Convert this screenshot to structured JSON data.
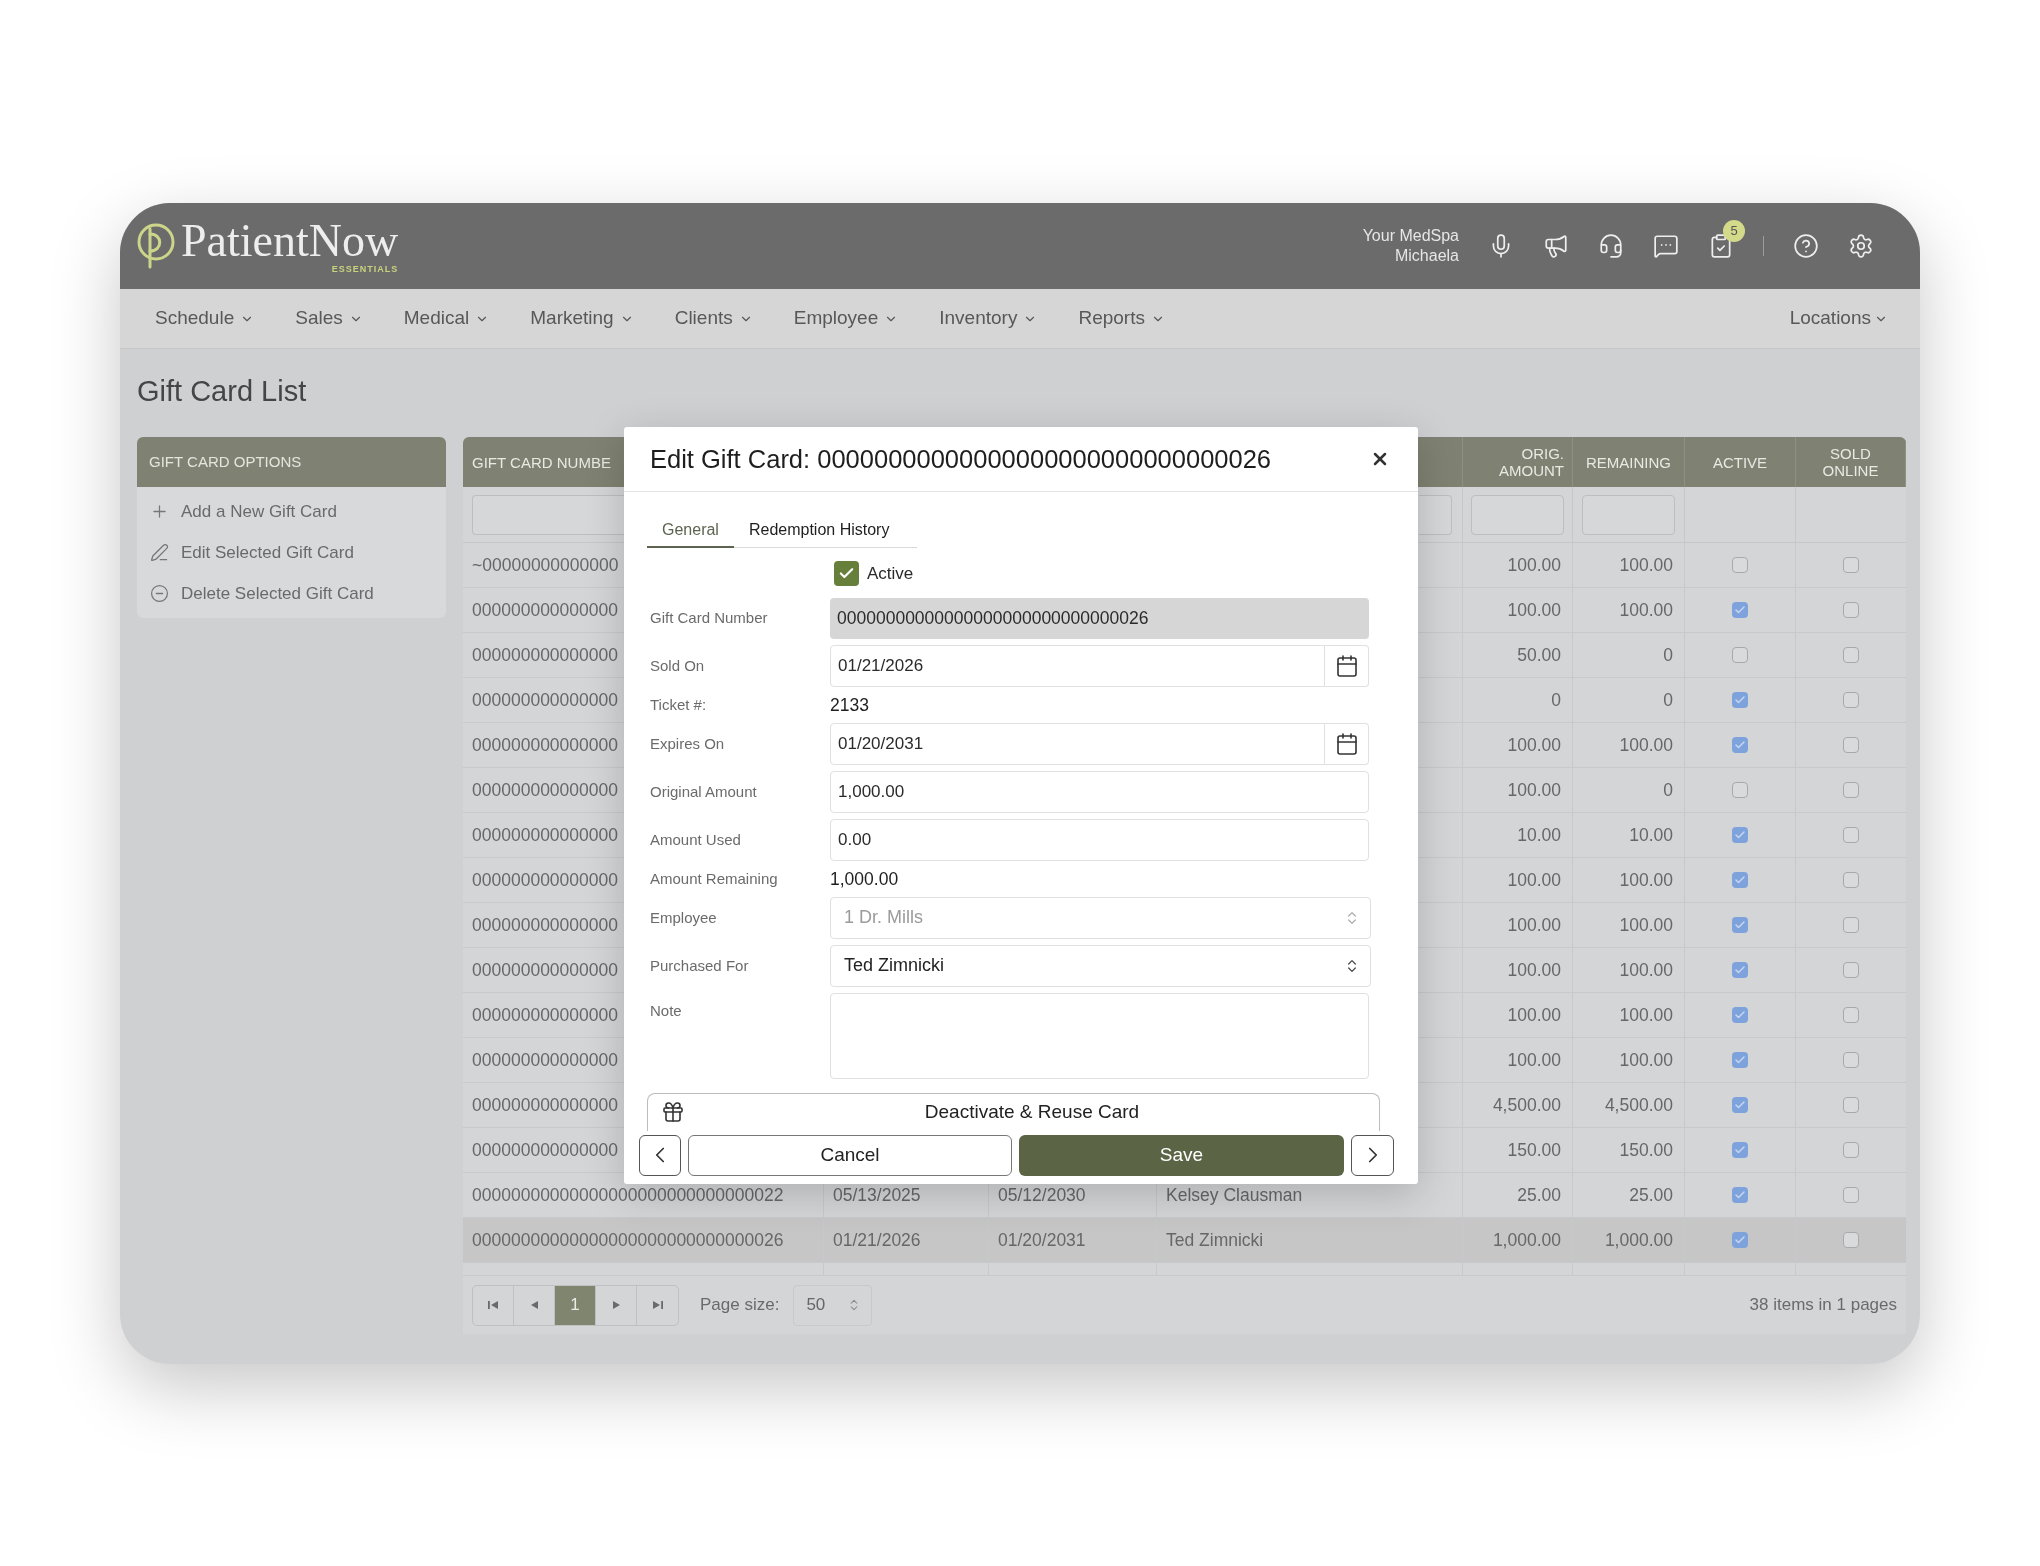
{
  "header": {
    "logo": {
      "name": "PatientNow",
      "tagline": "ESSENTIALS"
    },
    "account": {
      "business": "Your MedSpa",
      "user": "Michaela"
    },
    "tasks_badge": "5"
  },
  "nav": {
    "items": [
      "Schedule",
      "Sales",
      "Medical",
      "Marketing",
      "Clients",
      "Employee",
      "Inventory",
      "Reports"
    ],
    "locations": "Locations"
  },
  "page_title": "Gift Card List",
  "sidebar": {
    "title": "GIFT CARD OPTIONS",
    "items": [
      {
        "kind": "add",
        "label": "Add a New Gift Card"
      },
      {
        "kind": "edit",
        "label": "Edit Selected Gift Card"
      },
      {
        "kind": "delete",
        "label": "Delete Selected Gift Card"
      }
    ]
  },
  "table": {
    "columns": [
      "GIFT CARD NUMBE",
      "ORIG. AMOUNT",
      "REMAINING",
      "ACTIVE",
      "SOLD ONLINE"
    ],
    "rows": [
      {
        "gift_card_number": "~00000000000000",
        "orig_amount": "100.00",
        "remaining": "100.00",
        "active": false,
        "sold_online": false,
        "selected": false
      },
      {
        "gift_card_number": "000000000000000",
        "orig_amount": "100.00",
        "remaining": "100.00",
        "active": true,
        "sold_online": false,
        "selected": false
      },
      {
        "gift_card_number": "000000000000000",
        "orig_amount": "50.00",
        "remaining": "0",
        "active": false,
        "sold_online": false,
        "selected": false
      },
      {
        "gift_card_number": "000000000000000",
        "orig_amount": "0",
        "remaining": "0",
        "active": true,
        "sold_online": false,
        "selected": false
      },
      {
        "gift_card_number": "000000000000000",
        "orig_amount": "100.00",
        "remaining": "100.00",
        "active": true,
        "sold_online": false,
        "selected": false
      },
      {
        "gift_card_number": "000000000000000",
        "orig_amount": "100.00",
        "remaining": "0",
        "active": false,
        "sold_online": false,
        "selected": false
      },
      {
        "gift_card_number": "000000000000000",
        "orig_amount": "10.00",
        "remaining": "10.00",
        "active": true,
        "sold_online": false,
        "selected": false
      },
      {
        "gift_card_number": "000000000000000",
        "orig_amount": "100.00",
        "remaining": "100.00",
        "active": true,
        "sold_online": false,
        "selected": false
      },
      {
        "gift_card_number": "000000000000000",
        "orig_amount": "100.00",
        "remaining": "100.00",
        "active": true,
        "sold_online": false,
        "selected": false
      },
      {
        "gift_card_number": "000000000000000",
        "orig_amount": "100.00",
        "remaining": "100.00",
        "active": true,
        "sold_online": false,
        "selected": false
      },
      {
        "gift_card_number": "000000000000000",
        "orig_amount": "100.00",
        "remaining": "100.00",
        "active": true,
        "sold_online": false,
        "selected": false
      },
      {
        "gift_card_number": "000000000000000",
        "orig_amount": "100.00",
        "remaining": "100.00",
        "active": true,
        "sold_online": false,
        "selected": false
      },
      {
        "gift_card_number": "000000000000000",
        "orig_amount": "4,500.00",
        "remaining": "4,500.00",
        "active": true,
        "sold_online": false,
        "selected": false
      },
      {
        "gift_card_number": "000000000000000",
        "orig_amount": "150.00",
        "remaining": "150.00",
        "active": true,
        "sold_online": false,
        "selected": false
      },
      {
        "gift_card_number": "00000000000000000000000000000022",
        "column_2": "05/13/2025",
        "column_3": "05/12/2030",
        "column_4": "Kelsey Clausman",
        "orig_amount": "25.00",
        "remaining": "25.00",
        "active": true,
        "sold_online": false,
        "selected": false
      },
      {
        "gift_card_number": "00000000000000000000000000000026",
        "column_2": "01/21/2026",
        "column_3": "01/20/2031",
        "column_4": "Ted Zimnicki",
        "orig_amount": "1,000.00",
        "remaining": "1,000.00",
        "active": true,
        "sold_online": false,
        "selected": true
      }
    ]
  },
  "pagination": {
    "pages": [
      {
        "label": "1",
        "selected": true
      }
    ],
    "page_size_label": "Page size:",
    "page_size": "50",
    "summary": "38 items in 1 pages"
  },
  "dialog": {
    "title": "Edit Gift Card: 00000000000000000000000000000026",
    "tabs": [
      {
        "label": "General",
        "selected": true
      },
      {
        "label": "Redemption History",
        "selected": false
      }
    ],
    "active": {
      "label": "Active",
      "checked": true
    },
    "fields": [
      {
        "kind": "readonly",
        "label": "Gift Card Number",
        "value": "00000000000000000000000000000026"
      },
      {
        "kind": "date",
        "label": "Sold On",
        "value": "01/21/2026"
      },
      {
        "kind": "text",
        "label": "Ticket #:",
        "value": "2133"
      },
      {
        "kind": "date",
        "label": "Expires On",
        "value": "01/20/2031"
      },
      {
        "kind": "input",
        "label": "Original Amount",
        "value": "1,000.00"
      },
      {
        "kind": "input",
        "label": "Amount Used",
        "value": "0.00"
      },
      {
        "kind": "text",
        "label": "Amount Remaining",
        "value": "1,000.00"
      },
      {
        "kind": "select",
        "label": "Employee",
        "value": "1 Dr. Mills",
        "disabled": true
      },
      {
        "kind": "select",
        "label": "Purchased For",
        "value": "Ted Zimnicki",
        "disabled": false
      },
      {
        "kind": "textarea",
        "label": "Note"
      }
    ],
    "deactivate_button": "Deactivate & Reuse Card",
    "cancel_button": "Cancel",
    "save_button": "Save"
  }
}
